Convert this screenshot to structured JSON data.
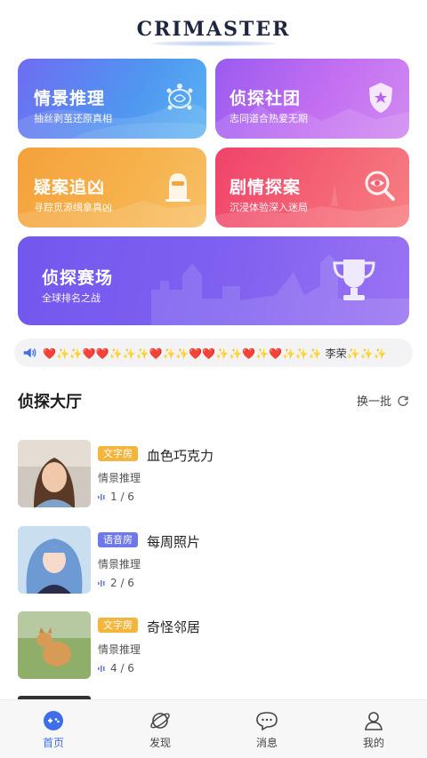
{
  "header": {
    "logo": "CRIMASTER"
  },
  "cards": [
    {
      "title": "情景推理",
      "subtitle": "抽丝剥茧还原真相",
      "icon": "turtle-icon"
    },
    {
      "title": "侦探社团",
      "subtitle": "志同道合热爱无期",
      "icon": "police-badge-icon"
    },
    {
      "title": "疑案追凶",
      "subtitle": "寻踪觅源缉拿真凶",
      "icon": "masked-suspect-icon"
    },
    {
      "title": "剧情探案",
      "subtitle": "沉浸体验深入迷局",
      "icon": "magnifier-eye-icon"
    },
    {
      "title": "侦探赛场",
      "subtitle": "全球排名之战",
      "icon": "trophy-icon"
    }
  ],
  "marquee": {
    "text": "❤️✨✨❤️❤️✨✨✨❤️✨✨❤️❤️✨✨❤️✨❤️✨✨✨ 李荣✨✨✨"
  },
  "hall": {
    "title": "侦探大厅",
    "refresh_label": "换一批"
  },
  "rooms": [
    {
      "type": "文字房",
      "title": "血色巧克力",
      "category": "情景推理",
      "count": "1 / 6"
    },
    {
      "type": "语音房",
      "title": "每周照片",
      "category": "情景推理",
      "count": "2 / 6"
    },
    {
      "type": "文字房",
      "title": "奇怪邻居",
      "category": "情景推理",
      "count": "4 / 6"
    }
  ],
  "nav": [
    {
      "label": "首页",
      "active": true
    },
    {
      "label": "发现",
      "active": false
    },
    {
      "label": "消息",
      "active": false
    },
    {
      "label": "我的",
      "active": false
    }
  ],
  "colors": {
    "accent": "#3f6ee8",
    "text_tag": "#f3b53c",
    "voice_tag": "#6f78ea"
  }
}
